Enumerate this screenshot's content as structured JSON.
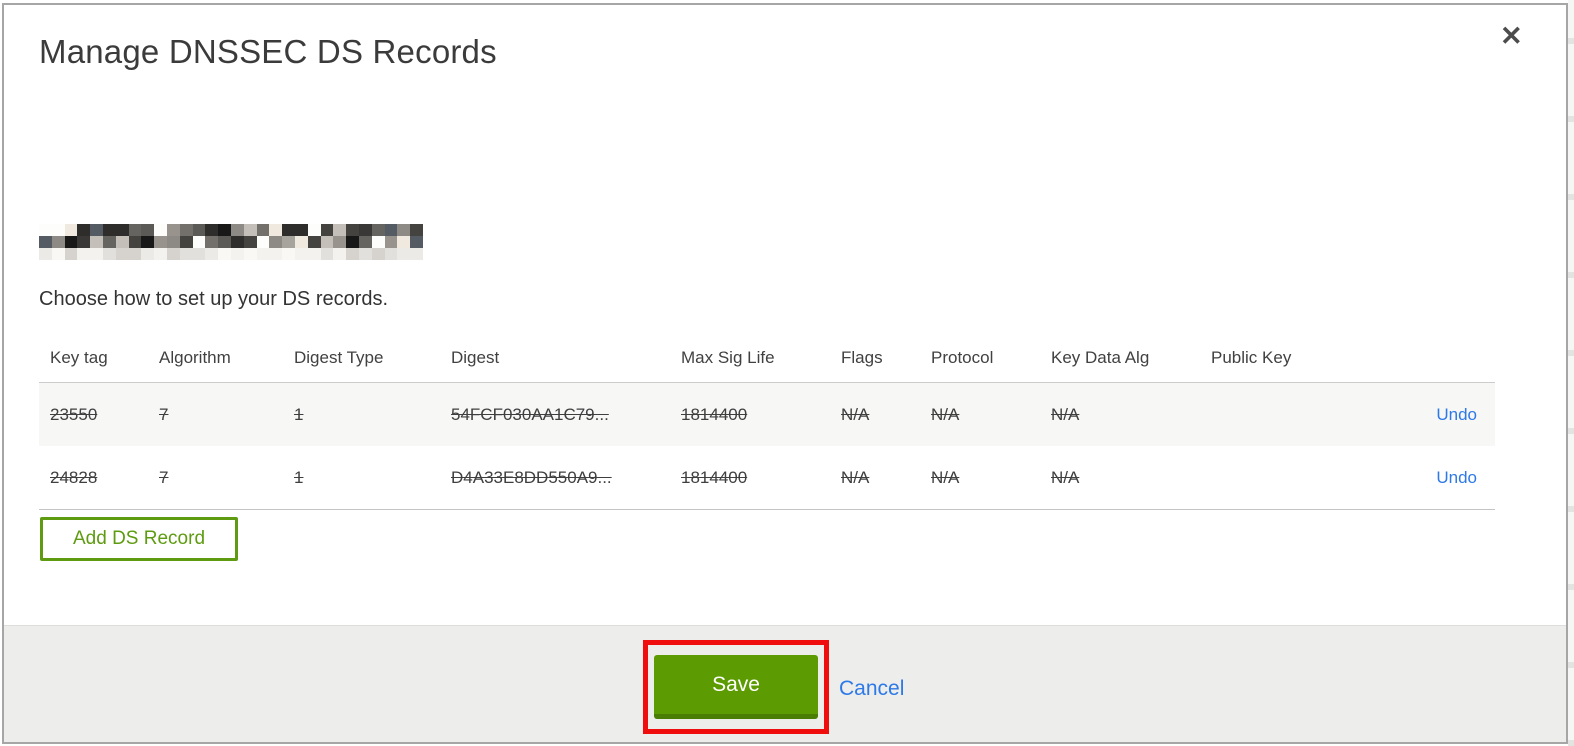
{
  "modal": {
    "title": "Manage DNSSEC DS Records",
    "close_icon": "✕",
    "intro": "Choose how to set up your DS records.",
    "domain": {
      "redacted": true
    }
  },
  "table": {
    "headers": [
      "Key tag",
      "Algorithm",
      "Digest Type",
      "Digest",
      "Max Sig Life",
      "Flags",
      "Protocol",
      "Key Data Alg",
      "Public Key"
    ],
    "rows": [
      {
        "key_tag": "23550",
        "algorithm": "7",
        "digest_type": "1",
        "digest": "54FCF030AA1C79...",
        "max_sig_life": "1814400",
        "flags": "N/A",
        "protocol": "N/A",
        "key_data_alg": "N/A",
        "public_key": "",
        "action": "Undo",
        "marked_for_deletion": true
      },
      {
        "key_tag": "24828",
        "algorithm": "7",
        "digest_type": "1",
        "digest": "D4A33E8DD550A9...",
        "max_sig_life": "1814400",
        "flags": "N/A",
        "protocol": "N/A",
        "key_data_alg": "N/A",
        "public_key": "",
        "action": "Undo",
        "marked_for_deletion": true
      }
    ]
  },
  "buttons": {
    "add_ds_record": "Add DS Record",
    "save": "Save",
    "cancel": "Cancel"
  },
  "colors": {
    "accent_green": "#5c9b02",
    "accent_green_dark": "#4a7d04",
    "outline_green": "#5e9b10",
    "link_blue": "#2d79e8",
    "annotation_red": "#ef0d0d",
    "footer_gray": "#ededec",
    "row_stripe": "#f7f7f6"
  }
}
